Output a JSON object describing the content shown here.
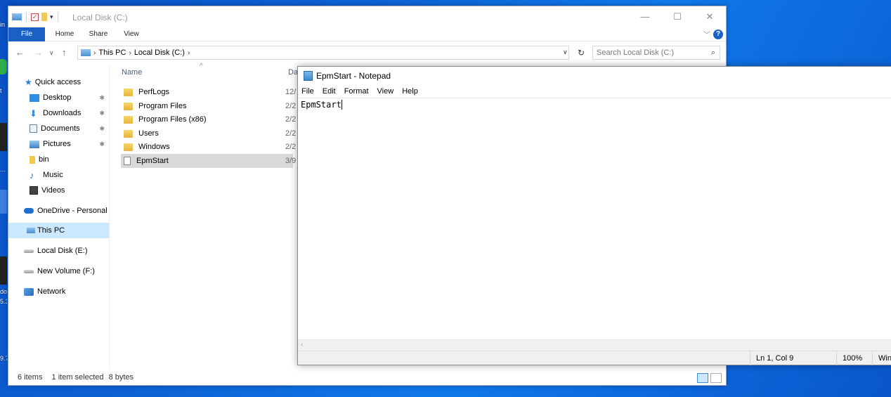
{
  "desktop": {
    "fragments": [
      "in",
      "t",
      "...",
      "do",
      "5.3",
      "9.7"
    ]
  },
  "explorer": {
    "title": "Local Disk (C:)",
    "window_buttons": {
      "minimize": "—",
      "maximize": "☐",
      "close": "✕"
    },
    "ribbon": {
      "tabs": [
        "File",
        "Home",
        "Share",
        "View"
      ],
      "help": "?"
    },
    "address": {
      "segments": [
        "This PC",
        "Local Disk (C:)"
      ],
      "search_placeholder": "Search Local Disk (C:)"
    },
    "nav": {
      "quick_access": "Quick access",
      "items": [
        {
          "label": "Desktop",
          "pinned": true
        },
        {
          "label": "Downloads",
          "pinned": true
        },
        {
          "label": "Documents",
          "pinned": true
        },
        {
          "label": "Pictures",
          "pinned": true
        },
        {
          "label": "bin",
          "pinned": false
        },
        {
          "label": "Music",
          "pinned": false
        },
        {
          "label": "Videos",
          "pinned": false
        }
      ],
      "onedrive": "OneDrive - Personal",
      "this_pc": "This PC",
      "local_disk_e": "Local Disk (E:)",
      "new_volume_f": "New Volume (F:)",
      "network": "Network"
    },
    "columns": {
      "name": "Name",
      "date": "Da"
    },
    "files": [
      {
        "name": "PerfLogs",
        "type": "folder",
        "date": "12/"
      },
      {
        "name": "Program Files",
        "type": "folder",
        "date": "2/2"
      },
      {
        "name": "Program Files (x86)",
        "type": "folder",
        "date": "2/2"
      },
      {
        "name": "Users",
        "type": "folder",
        "date": "2/2"
      },
      {
        "name": "Windows",
        "type": "folder",
        "date": "2/2"
      },
      {
        "name": "EpmStart",
        "type": "file",
        "date": "3/9"
      }
    ],
    "status": {
      "count": "6 items",
      "selected": "1 item selected",
      "size": "8 bytes"
    }
  },
  "notepad": {
    "title": "EpmStart - Notepad",
    "menu": [
      "File",
      "Edit",
      "Format",
      "View",
      "Help"
    ],
    "content": "EpmStart",
    "status": {
      "position": "Ln 1, Col 9",
      "zoom": "100%",
      "eol": "Wind"
    }
  }
}
